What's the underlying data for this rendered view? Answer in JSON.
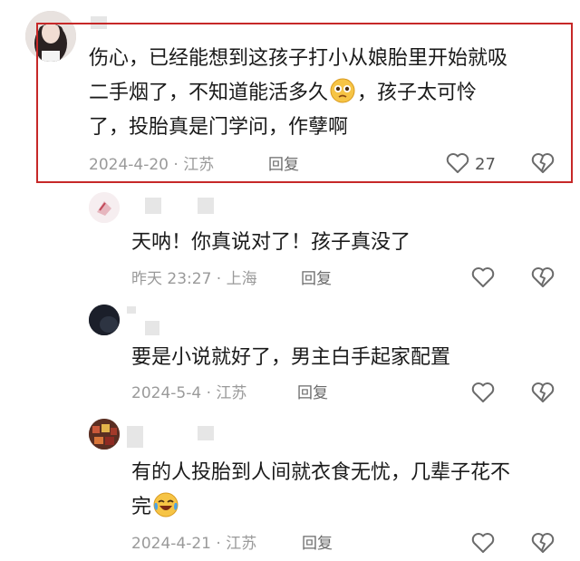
{
  "comments": [
    {
      "lines": [
        "伤心，已经能想到这孩子打小从娘胎里开始就吸",
        "二手烟了，不知道能活多久",
        "，孩子太可怜",
        "了，投胎真是门学问，作孽啊"
      ],
      "meta": "2024-4-20 · 江苏",
      "reply": "回复",
      "likes": "27"
    },
    {
      "lines": [
        "天呐！你真说对了！孩子真没了"
      ],
      "meta": "昨天 23:27 · 上海",
      "reply": "回复"
    },
    {
      "lines": [
        "要是小说就好了，男主白手起家配置"
      ],
      "meta": "2024-5-4 · 江苏",
      "reply": "回复"
    },
    {
      "lines": [
        "有的人投胎到人间就衣食无忧，几辈子花不",
        "完"
      ],
      "meta": "2024-4-21 · 江苏",
      "reply": "回复"
    }
  ],
  "icons": {
    "like": "heart-outline-icon",
    "dislike": "broken-heart-icon",
    "emoji1": "worried-face-emoji-icon",
    "emoji2": "crying-laughing-emoji-icon"
  },
  "colors": {
    "highlight": "#c62828",
    "meta": "#9a9a9a",
    "text": "#1a1a1a"
  }
}
